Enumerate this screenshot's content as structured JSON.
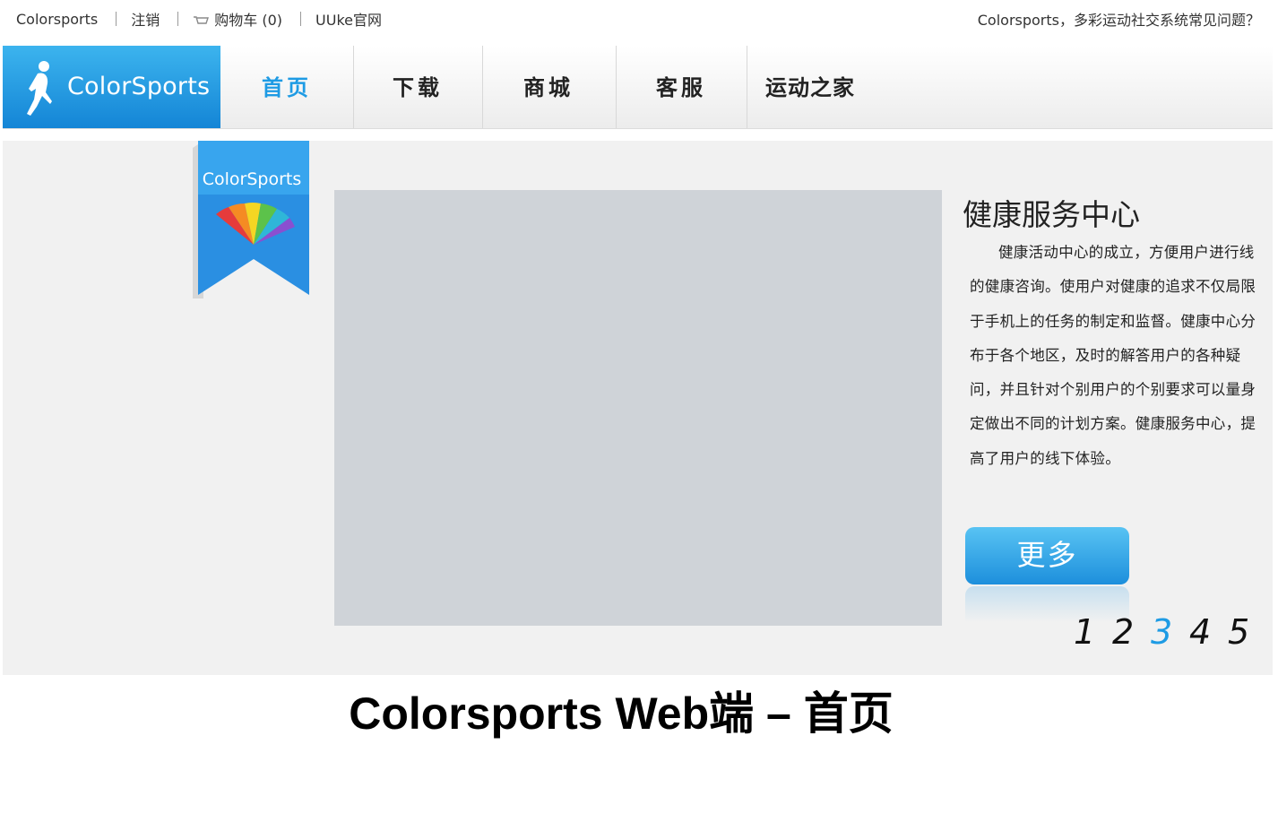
{
  "topbar": {
    "links": [
      "Colorsports",
      "注销",
      "购物车 (0)",
      "UUke官网"
    ],
    "faq": "Colorsports，多彩运动社交系统常见问题？"
  },
  "logo": {
    "text": "ColorSports"
  },
  "nav": {
    "items": [
      "首页",
      "下载",
      "商城",
      "客服",
      "运动之家"
    ],
    "active_index": 0
  },
  "banner": {
    "ribbon_text": "ColorSports",
    "panel": {
      "title": "健康服务中心",
      "body": "健康活动中心的成立，方便用户进行线的健康咨询。使用户对健康的追求不仅局限于手机上的任务的制定和监督。健康中心分布于各个地区，及时的解答用户的各种疑问，并且针对个别用户的个别要求可以量身定做出不同的计划方案。健康服务中心，提高了用户的线下体验。",
      "more_label": "更多"
    },
    "pager": {
      "pages": [
        "1",
        "2",
        "3",
        "4",
        "5"
      ],
      "active_index": 2
    }
  },
  "caption": "Colorsports Web端 – 首页",
  "colors": {
    "accent": "#1e9be4",
    "logo_bg": "#1485d6",
    "banner_bg": "#f1f1f1"
  },
  "icons": {
    "runner": "runner-icon",
    "cart": "cart-icon",
    "rainbow": "rainbow-fan-icon"
  }
}
